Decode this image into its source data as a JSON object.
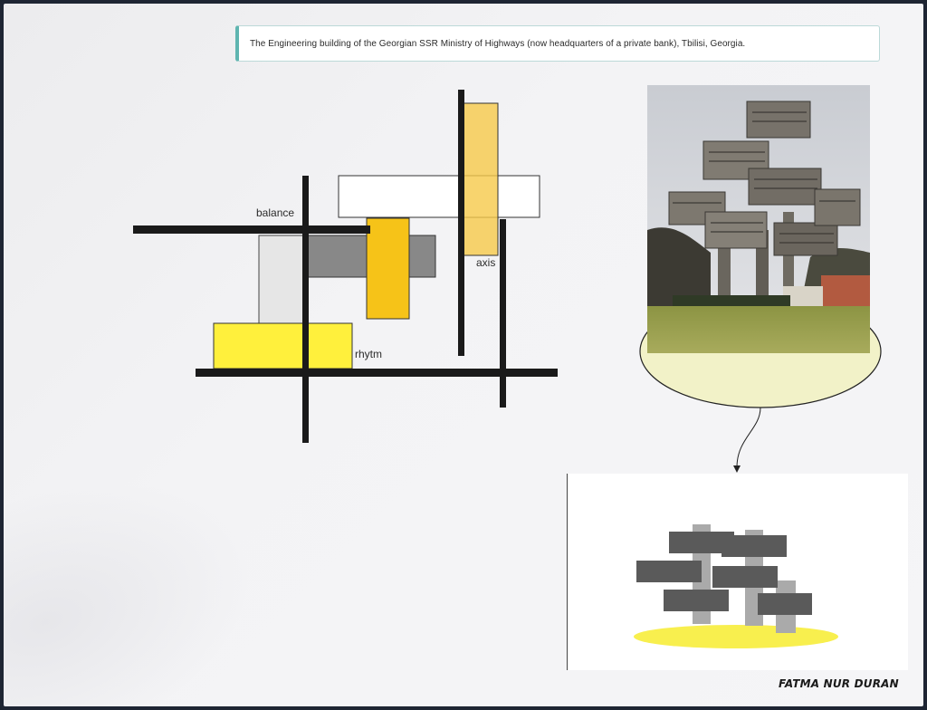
{
  "caption": {
    "text": "The Engineering building of the Georgian SSR Ministry of Highways (now headquarters of a private bank), Tbilisi, Georgia."
  },
  "labels": {
    "balance": "balance",
    "axis": "axis",
    "rhytm": "rhytm"
  },
  "signature": "FATMA NUR DURAN",
  "colors": {
    "accent_border": "#5fb5b0",
    "yellow": "#fff03c",
    "amber": "#f6c318",
    "light_amber": "#f7d873",
    "grey": "#8a8a8a",
    "light_grey": "#e6e6e6",
    "bubble": "#f2f2c8",
    "line": "#1a1a1a"
  }
}
